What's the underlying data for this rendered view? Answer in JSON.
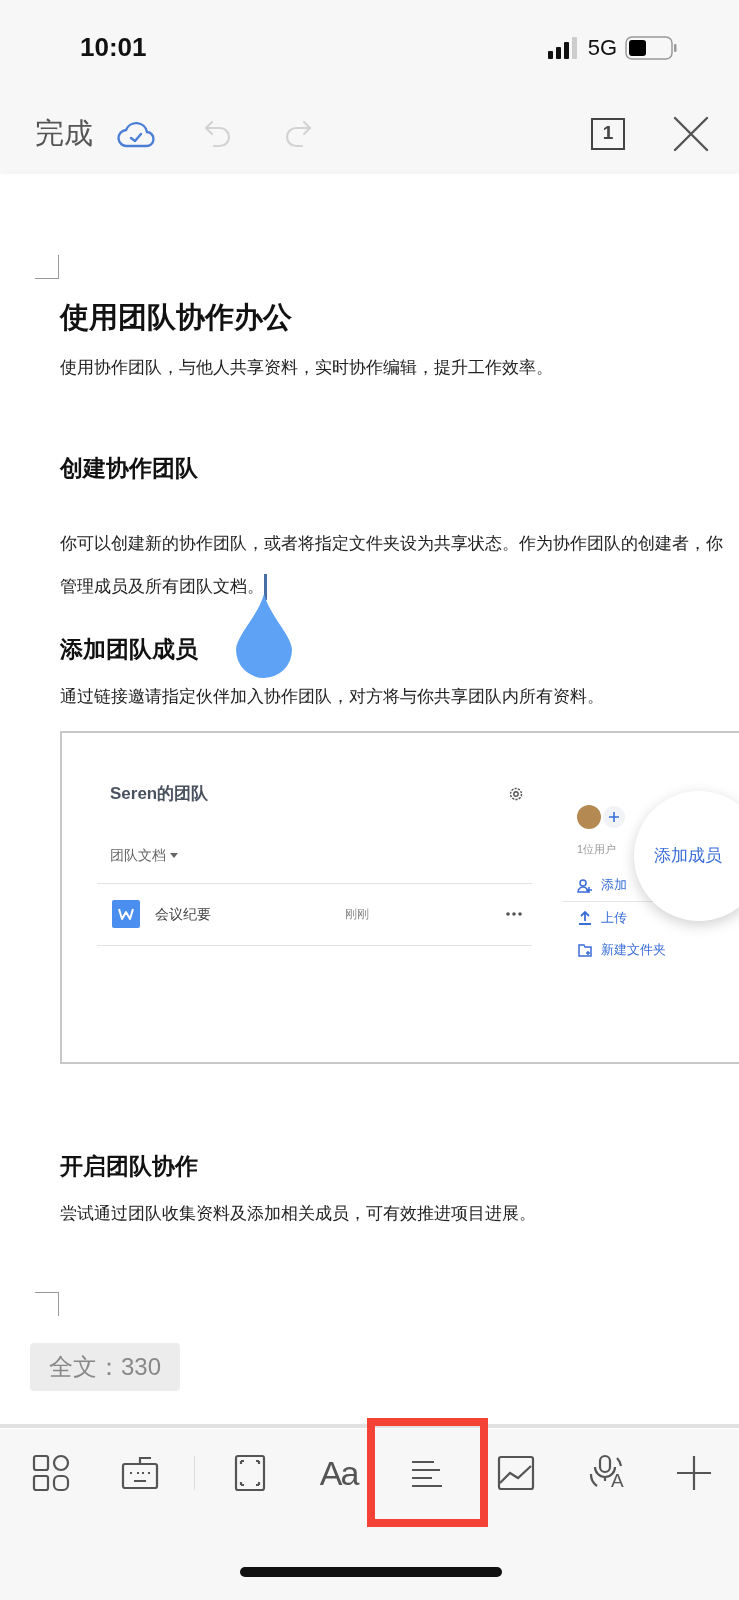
{
  "status_bar": {
    "time": "10:01",
    "network": "5G"
  },
  "top_toolbar": {
    "done_label": "完成",
    "cloud_synced": true,
    "undo_disabled": true,
    "redo_disabled": true,
    "page_number": "1"
  },
  "document": {
    "blocks": [
      {
        "kind": "corner_top"
      },
      {
        "kind": "title",
        "text": "使用团队协作办公"
      },
      {
        "kind": "paragraph",
        "lines": [
          "使用协作团队，与他人共享资料，实时协作编辑，提升工作效率。"
        ]
      },
      {
        "kind": "heading",
        "text": "创建协作团队"
      },
      {
        "kind": "paragraph",
        "lines": [
          "你可以创建新的协作团队，或者将指定文件夹设为共享状态。作为协作团队的创建者，你",
          "管理成员及所有团队文档。"
        ],
        "cursor": true
      },
      {
        "kind": "heading",
        "text": "添加团队成员"
      },
      {
        "kind": "paragraph",
        "lines": [
          "通过链接邀请指定伙伴加入协作团队，对方将与你共享团队内所有资料。"
        ]
      },
      {
        "kind": "image",
        "team_name": "Seren的团队",
        "folder_label": "团队文档",
        "files": [
          {
            "name": "会议纪要",
            "time": "刚刚"
          }
        ],
        "member_note": "1位用户",
        "actions": [
          "添加",
          "上传",
          "新建文件夹"
        ],
        "callout": "添加成员"
      },
      {
        "kind": "heading",
        "text": "开启团队协作"
      },
      {
        "kind": "paragraph",
        "lines": [
          "尝试通过团队收集资料及添加相关成员，可有效推进项目进展。"
        ]
      },
      {
        "kind": "corner_bottom"
      }
    ]
  },
  "word_count": "全文：330",
  "bottom_toolbar": {
    "items": [
      {
        "kind": "apps",
        "highlighted": false
      },
      {
        "kind": "keyboard",
        "highlighted": false
      },
      {
        "kind": "divider"
      },
      {
        "kind": "frame",
        "highlighted": false
      },
      {
        "kind": "font",
        "label": "Aa",
        "highlighted": false
      },
      {
        "kind": "align",
        "highlighted": true
      },
      {
        "kind": "image",
        "highlighted": false
      },
      {
        "kind": "voice",
        "label": "A",
        "highlighted": false
      },
      {
        "kind": "plus",
        "highlighted": false
      }
    ]
  }
}
